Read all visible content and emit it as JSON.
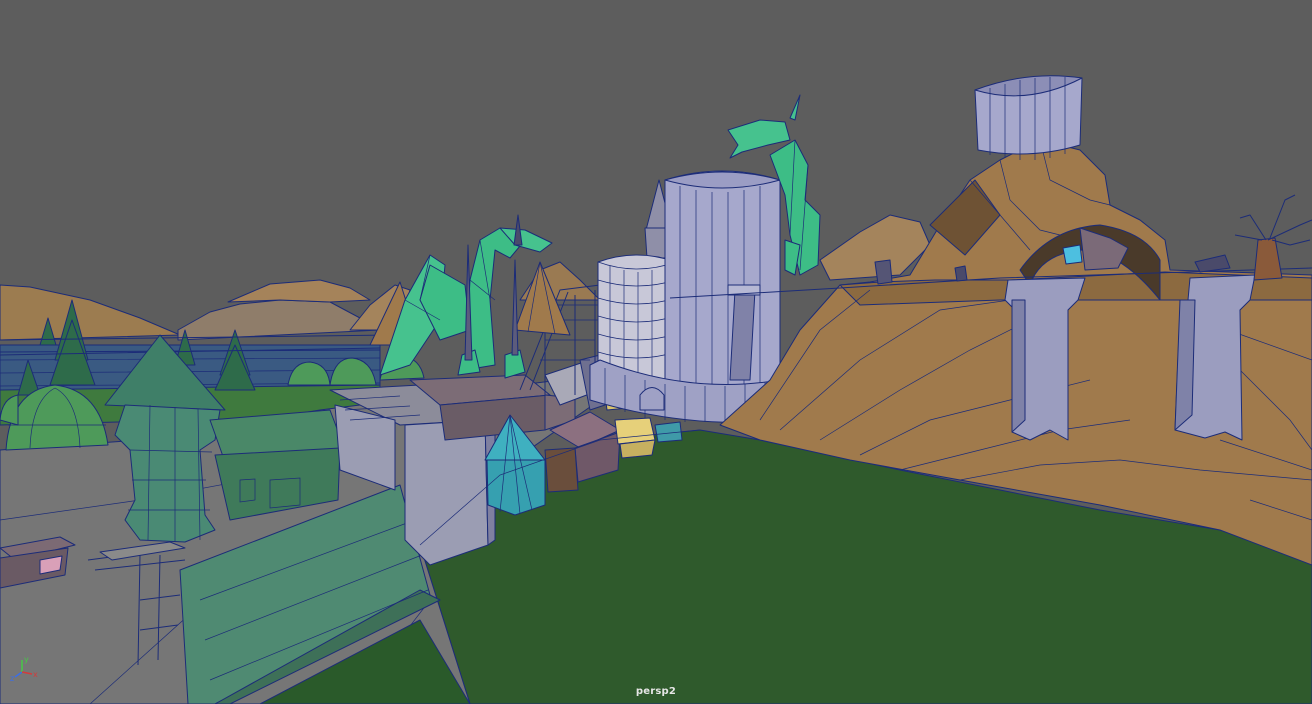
{
  "viewport": {
    "camera_name": "persp2",
    "background_color": "#5d5d5d"
  },
  "axis_gizmo": {
    "x_label": "x",
    "y_label": "y",
    "z_label": "z",
    "x_color": "#d23c3c",
    "y_color": "#46c846",
    "z_color": "#3c6ee6"
  },
  "scene_colors": {
    "ground_grass": "#2f5a2c",
    "ground_path": "#737373",
    "rock": "#a07a4c",
    "rock_shadow": "#7e5e3a",
    "tower": "#9b9dc8",
    "dragon": "#3dbd86",
    "buildings_green": "#4a8868",
    "buildings_purple": "#908598",
    "water": "#3a5a82",
    "wireframe": "#1c2c78"
  }
}
